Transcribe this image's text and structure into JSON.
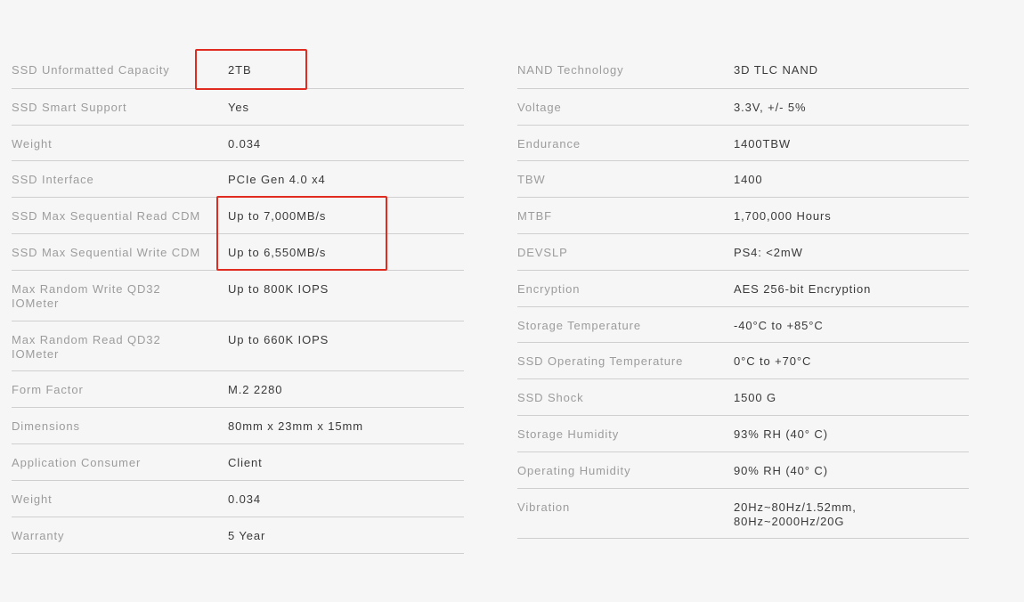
{
  "left_specs": [
    {
      "label": "SSD Unformatted Capacity",
      "value": "2TB"
    },
    {
      "label": "SSD Smart Support",
      "value": "Yes"
    },
    {
      "label": "Weight",
      "value": "0.034"
    },
    {
      "label": "SSD Interface",
      "value": "PCIe Gen 4.0 x4"
    },
    {
      "label": "SSD Max Sequential Read CDM",
      "value": "Up to 7,000MB/s"
    },
    {
      "label": "SSD Max Sequential Write CDM",
      "value": "Up to 6,550MB/s"
    },
    {
      "label": "Max Random Write QD32 IOMeter",
      "value": "Up to 800K IOPS"
    },
    {
      "label": "Max Random Read QD32 IOMeter",
      "value": "Up to 660K IOPS"
    },
    {
      "label": "Form Factor",
      "value": "M.2 2280"
    },
    {
      "label": "Dimensions",
      "value": "80mm x 23mm x 15mm"
    },
    {
      "label": "Application Consumer",
      "value": "Client"
    },
    {
      "label": "Weight",
      "value": "0.034"
    },
    {
      "label": "Warranty",
      "value": "5 Year"
    }
  ],
  "right_specs": [
    {
      "label": "NAND Technology",
      "value": "3D TLC NAND"
    },
    {
      "label": "Voltage",
      "value": "3.3V, +/- 5%"
    },
    {
      "label": "Endurance",
      "value": "1400TBW"
    },
    {
      "label": "TBW",
      "value": "1400"
    },
    {
      "label": "MTBF",
      "value": "1,700,000 Hours"
    },
    {
      "label": "DEVSLP",
      "value": "PS4: <2mW"
    },
    {
      "label": "Encryption",
      "value": "AES 256-bit Encryption"
    },
    {
      "label": "Storage Temperature",
      "value": "-40°C to +85°C"
    },
    {
      "label": "SSD Operating Temperature",
      "value": "0°C to +70°C"
    },
    {
      "label": "SSD Shock",
      "value": "1500 G"
    },
    {
      "label": "Storage Humidity",
      "value": "93% RH (40° C)"
    },
    {
      "label": "Operating Humidity",
      "value": "90% RH (40° C)"
    },
    {
      "label": "Vibration",
      "value": "20Hz~80Hz/1.52mm, 80Hz~2000Hz/20G"
    }
  ],
  "colors": {
    "background": "#f6f6f6",
    "label": "#9c9c9c",
    "value": "#3a3a3a",
    "divider": "#cfcfcf",
    "highlight": "#e02b20"
  }
}
